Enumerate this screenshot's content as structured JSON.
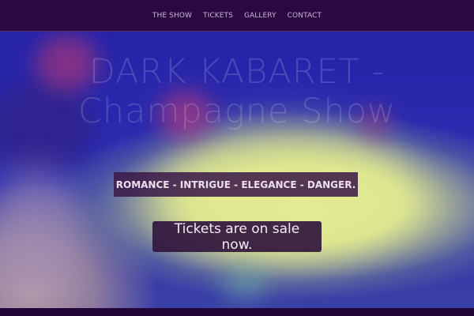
{
  "nav": {
    "items": [
      {
        "label": "THE SHOW"
      },
      {
        "label": "TICKETS"
      },
      {
        "label": "GALLERY"
      },
      {
        "label": "CONTACT"
      }
    ]
  },
  "hero": {
    "title_line1": "DARK KABARET -",
    "title_line2": "Champagne Show",
    "tagline": "ROMANCE - INTRIGUE - ELEGANCE - DANGER.",
    "cta_label": "Tickets are on sale now."
  },
  "colors": {
    "nav_background": "#2c0841",
    "accent_dark": "#3a1848",
    "hero_blue": "#2523a8",
    "hero_yellow": "#e2eb8e",
    "hero_pink": "#a0357b"
  }
}
